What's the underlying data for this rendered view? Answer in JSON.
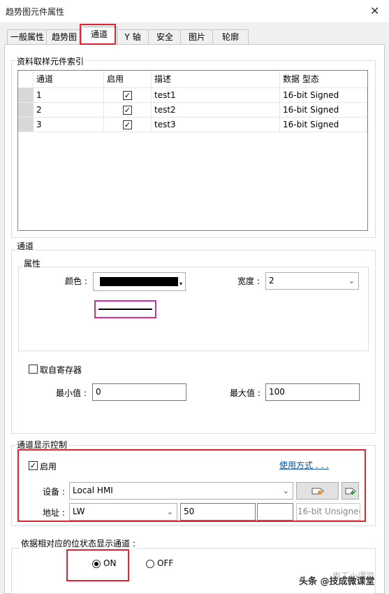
{
  "window": {
    "title": "趋势图元件属性",
    "close_glyph": "✕"
  },
  "tabs": [
    "一般属性",
    "趋势图",
    "通道",
    "Y 轴",
    "安全",
    "图片",
    "轮廓"
  ],
  "active_tab": "通道",
  "index_group": {
    "label": "资料取样元件索引",
    "columns": [
      "通道",
      "启用",
      "描述",
      "数据 型态"
    ],
    "rows": [
      {
        "channel": "1",
        "enabled": true,
        "desc": "test1",
        "type": "16-bit Signed"
      },
      {
        "channel": "2",
        "enabled": true,
        "desc": "test2",
        "type": "16-bit Signed"
      },
      {
        "channel": "3",
        "enabled": true,
        "desc": "test3",
        "type": "16-bit Signed"
      }
    ]
  },
  "channel_group": {
    "label": "通道",
    "attr_label": "属性",
    "color_label": "颜色 :",
    "color_value": "#000000",
    "width_label": "宽度 :",
    "width_value": "2",
    "from_register_label": "取自寄存器",
    "from_register_checked": false,
    "min_label": "最小值 :",
    "min_value": "0",
    "max_label": "最大值 :",
    "max_value": "100"
  },
  "display_control": {
    "label": "通道显示控制",
    "enable_label": "启用",
    "enable_checked": true,
    "usage_link": "使用方式 . . .",
    "device_label": "设备 :",
    "device_value": "Local HMI",
    "address_label": "地址 :",
    "address_type": "LW",
    "address_value": "50",
    "data_type": "16-bit Unsignec"
  },
  "state_group": {
    "label": "依据相对应的位状态显示通道 :",
    "on_label": "ON",
    "off_label": "OFF",
    "selected": "ON"
  },
  "watermark": {
    "upper": "电工小课堂",
    "lower": "头条 @技成微课堂"
  },
  "colors": {
    "highlight": "#e0242f",
    "magenta_box": "#d62aa0",
    "link": "#0b4f9e"
  }
}
